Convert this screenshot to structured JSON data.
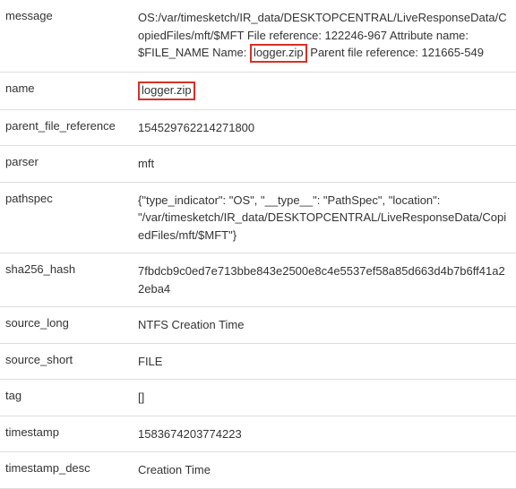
{
  "rows": {
    "message": {
      "key": "message",
      "pre": "OS:/var/timesketch/IR_data/DESKTOPCENTRAL/LiveResponseData/CopiedFiles/mft/$MFT File reference: 122246-967 Attribute name: $FILE_NAME Name: ",
      "highlight": "logger.zip",
      "post": " Parent file reference: 121665-549"
    },
    "name": {
      "key": "name",
      "highlight": "logger.zip"
    },
    "parent_file_reference": {
      "key": "parent_file_reference",
      "val": "154529762214271800"
    },
    "parser": {
      "key": "parser",
      "val": "mft"
    },
    "pathspec": {
      "key": "pathspec",
      "val": "{\"type_indicator\": \"OS\", \"__type__\": \"PathSpec\", \"location\": \"/var/timesketch/IR_data/DESKTOPCENTRAL/LiveResponseData/CopiedFiles/mft/$MFT\"}"
    },
    "sha256_hash": {
      "key": "sha256_hash",
      "val": "7fbdcb9c0ed7e713bbe843e2500e8c4e5537ef58a85d663d4b7b6ff41a22eba4"
    },
    "source_long": {
      "key": "source_long",
      "val": "NTFS Creation Time"
    },
    "source_short": {
      "key": "source_short",
      "val": "FILE"
    },
    "tag": {
      "key": "tag",
      "val": "[]"
    },
    "timestamp": {
      "key": "timestamp",
      "val": "1583674203774223"
    },
    "timestamp_desc": {
      "key": "timestamp_desc",
      "val": "Creation Time"
    }
  }
}
